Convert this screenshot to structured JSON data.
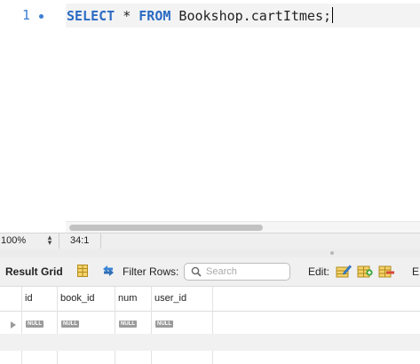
{
  "editor": {
    "line_number": "1",
    "code": {
      "kw1": "SELECT",
      "star": " * ",
      "kw2": "FROM",
      "rest": " Bookshop.cartItmes;"
    }
  },
  "status": {
    "zoom": "100%",
    "cursor_position": "34:1"
  },
  "toolbar": {
    "title": "Result Grid",
    "filter_label": "Filter Rows:",
    "search_placeholder": "Search",
    "edit_label": "Edit:",
    "export_label": "E:"
  },
  "grid": {
    "columns": [
      "id",
      "book_id",
      "num",
      "user_id"
    ],
    "rows": [
      [
        "NULL",
        "NULL",
        "NULL",
        "NULL"
      ]
    ]
  },
  "colors": {
    "keyword": "#2a6bc3",
    "line_number": "#3d7fd6",
    "null_badge": "#9b9b9b"
  }
}
